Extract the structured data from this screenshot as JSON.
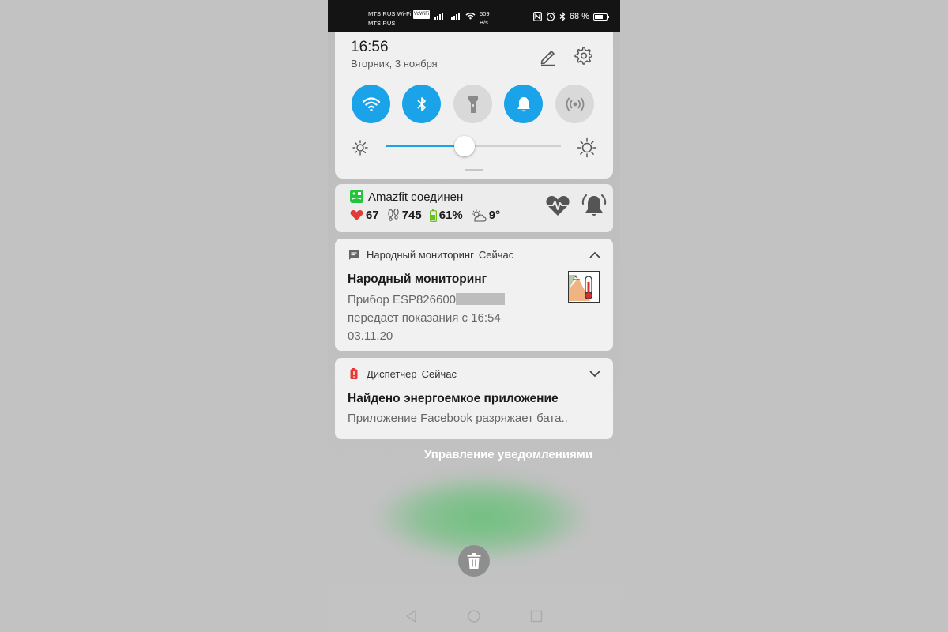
{
  "status_bar": {
    "carrier_primary": "MTS RUS Wi-Fi",
    "volte_badge": "VoWiFi",
    "carrier_secondary": "MTS RUS",
    "net_speed_value": "509",
    "net_speed_unit": "B/s",
    "battery_percent": "68 %",
    "icons": [
      "signal-icon",
      "signal-icon",
      "wifi-icon",
      "nfc-icon",
      "alarm-icon",
      "bluetooth-icon",
      "battery-icon"
    ]
  },
  "quick_settings": {
    "time": "16:56",
    "date": "Вторник, 3 ноября",
    "tiles": [
      {
        "name": "wifi",
        "icon": "wifi-icon",
        "on": true
      },
      {
        "name": "bluetooth",
        "icon": "bluetooth-icon",
        "on": true
      },
      {
        "name": "flashlight",
        "icon": "flashlight-icon",
        "on": false
      },
      {
        "name": "sound",
        "icon": "bell-icon",
        "on": true
      },
      {
        "name": "hotspot",
        "icon": "hotspot-icon",
        "on": false
      }
    ],
    "brightness_level": 0.45,
    "accent_color": "#1aa3e8"
  },
  "amazfit": {
    "title": "Amazfit соединен",
    "heart_rate": "67",
    "steps": "745",
    "battery": "61%",
    "weather": "9°"
  },
  "notifications": [
    {
      "app": "Народный мониторинг",
      "time": "Сейчас",
      "title": "Народный мониторинг",
      "body_line1": "Прибор ESP826600",
      "body_line2": "передает показания с 16:54",
      "body_line3": "03.11.20",
      "expanded": true
    },
    {
      "app": "Диспетчер",
      "time": "Сейчас",
      "title": "Найдено энергоемкое приложение",
      "body_line1": "Приложение Facebook разряжает бата..",
      "expanded": false
    }
  ],
  "manage_label": "Управление уведомлениями"
}
